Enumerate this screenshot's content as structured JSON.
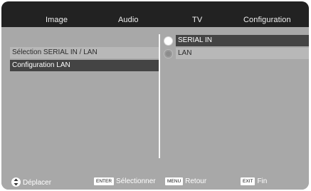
{
  "menu": {
    "tabs": [
      {
        "label": "Image"
      },
      {
        "label": "Audio"
      },
      {
        "label": "TV"
      },
      {
        "label": "Configuration"
      }
    ]
  },
  "left_panel": {
    "items": [
      {
        "label": "Sélection SERIAL IN / LAN"
      },
      {
        "label": "Configuration LAN"
      }
    ]
  },
  "right_panel": {
    "options": [
      {
        "label": "SERIAL IN",
        "selected": true
      },
      {
        "label": "LAN",
        "selected": false
      }
    ]
  },
  "footer": {
    "move_icon": "up-down-arrows-icon",
    "move_label": "Déplacer",
    "enter_key": "ENTER",
    "enter_label": "Sélectionner",
    "menu_key": "MENU",
    "menu_label": "Retour",
    "exit_key": "EXIT",
    "exit_label": "Fin"
  }
}
